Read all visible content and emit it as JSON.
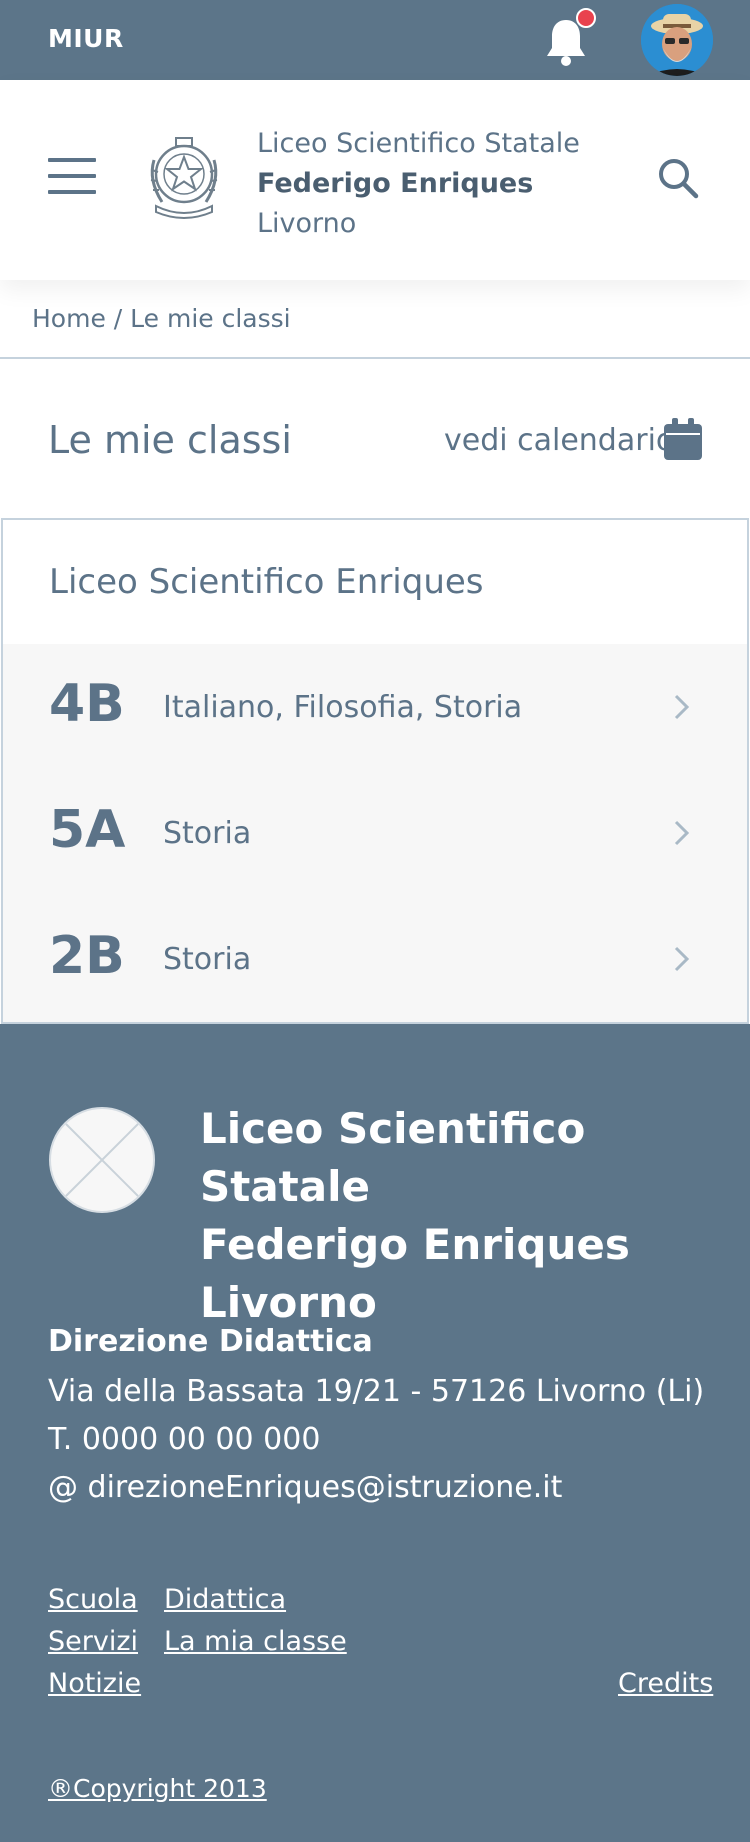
{
  "topbar": {
    "brand": "MIUR"
  },
  "header": {
    "school_line1": "Liceo Scientifico Statale",
    "school_line2": "Federigo Enriques",
    "school_line3": "Livorno"
  },
  "breadcrumb": {
    "home": "Home",
    "separator": "/",
    "current": "Le mie classi"
  },
  "page": {
    "title": "Le mie classi",
    "calendar_label": "vedi calendario"
  },
  "school_card": {
    "name": "Liceo Scientifico Enriques"
  },
  "classes": [
    {
      "code": "4B",
      "subjects": "Italiano, Filosofia, Storia"
    },
    {
      "code": "5A",
      "subjects": "Storia"
    },
    {
      "code": "2B",
      "subjects": "Storia"
    }
  ],
  "footer": {
    "name_line1": "Liceo Scientifico Statale",
    "name_line2": "Federigo Enriques",
    "name_line3": "Livorno",
    "direction_title": "Direzione Didattica",
    "address": "Via della Bassata 19/21 - 57126 Livorno (Li)",
    "phone": "T. 0000 00 00 000",
    "email": "@ direzioneEnriques@istruzione.it",
    "links": {
      "scuola": "Scuola",
      "didattica": "Didattica",
      "servizi": "Servizi",
      "la_mia_classe": "La mia classe",
      "notizie": "Notizie",
      "credits": "Credits"
    },
    "copyright": "®Copyright 2013"
  },
  "colors": {
    "primary": "#5c7589",
    "text": "#5c7388",
    "notification_dot": "#e9424e",
    "row_bg": "#f7f7f7",
    "border": "#c5d2dd"
  }
}
